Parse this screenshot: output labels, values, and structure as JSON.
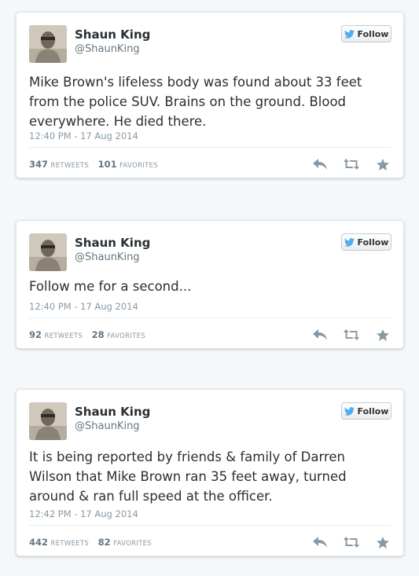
{
  "tweets": [
    {
      "name": "Shaun King",
      "handle": "@ShaunKing",
      "follow_label": "Follow",
      "text": "Mike Brown's lifeless body was found about 33 feet from the police SUV. Brains on the ground. Blood everywhere. He died there.",
      "timestamp": "12:40 PM - 17 Aug 2014",
      "retweets": "347",
      "retweets_label": "RETWEETS",
      "favorites": "101",
      "favorites_label": "FAVORITES"
    },
    {
      "name": "Shaun King",
      "handle": "@ShaunKing",
      "follow_label": "Follow",
      "text": "Follow me for a second...",
      "timestamp": "12:40 PM - 17 Aug 2014",
      "retweets": "92",
      "retweets_label": "RETWEETS",
      "favorites": "28",
      "favorites_label": "FAVORITES"
    },
    {
      "name": "Shaun King",
      "handle": "@ShaunKing",
      "follow_label": "Follow",
      "text": "It is being reported by friends & family of Darren Wilson that Mike Brown ran 35 feet away, turned around & ran full speed at the officer.",
      "timestamp": "12:42 PM - 17 Aug 2014",
      "retweets": "442",
      "retweets_label": "RETWEETS",
      "favorites": "82",
      "favorites_label": "FAVORITES"
    }
  ],
  "colors": {
    "background": "#f5f8fa",
    "twitter_blue": "#55acee",
    "text": "#292f33",
    "muted": "#8899a6",
    "action_icon": "#8899a6"
  },
  "icons": {
    "follow": "twitter-bird-icon",
    "reply": "reply-icon",
    "retweet": "retweet-icon",
    "favorite": "star-icon"
  }
}
